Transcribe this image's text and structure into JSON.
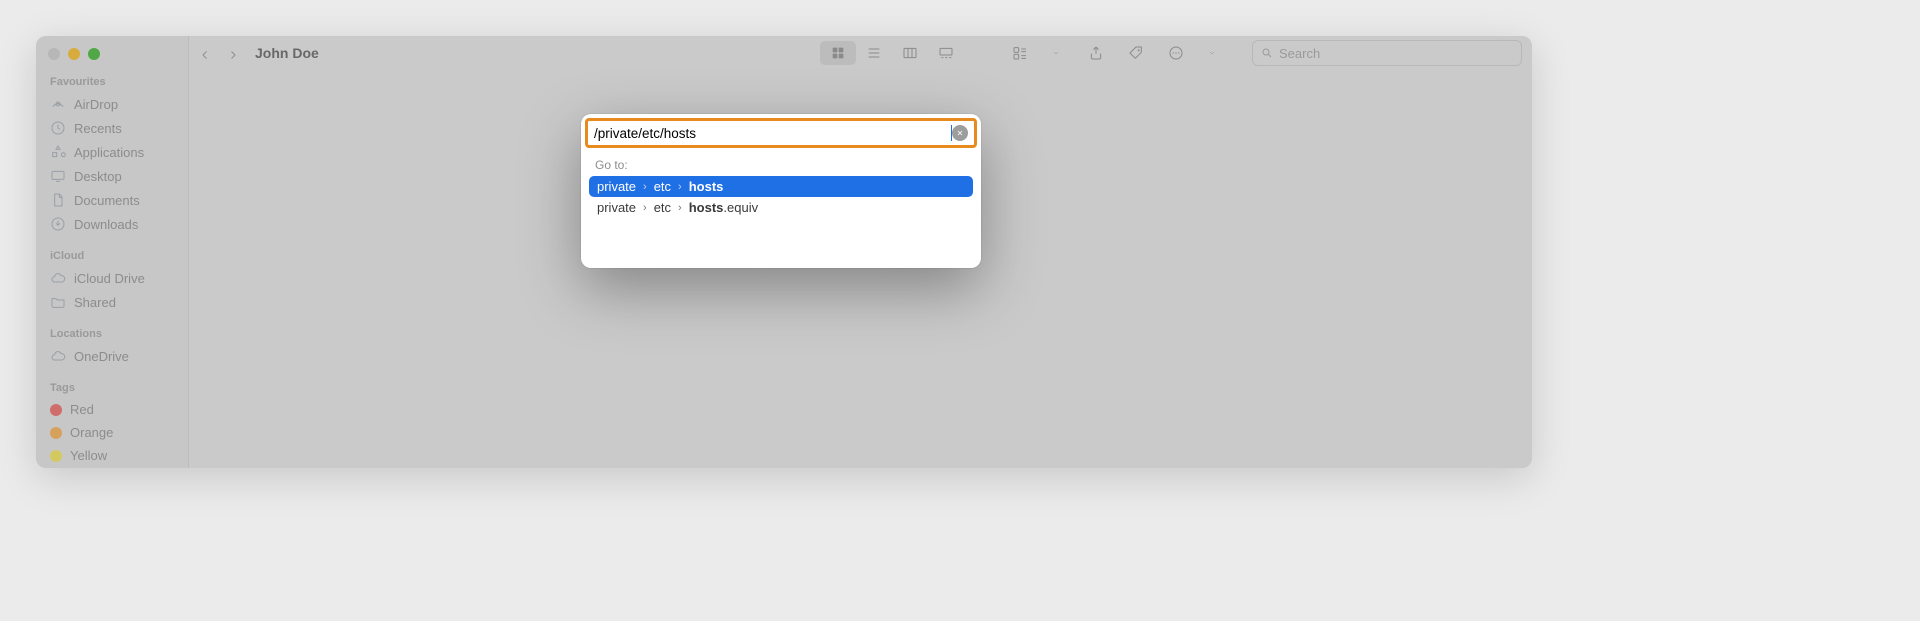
{
  "window": {
    "title": "John Doe",
    "search_placeholder": "Search"
  },
  "sidebar": {
    "sections": [
      {
        "title": "Favourites",
        "items": [
          {
            "icon": "airdrop-icon",
            "label": "AirDrop"
          },
          {
            "icon": "clock-icon",
            "label": "Recents"
          },
          {
            "icon": "apps-icon",
            "label": "Applications"
          },
          {
            "icon": "desktop-icon",
            "label": "Desktop"
          },
          {
            "icon": "document-icon",
            "label": "Documents"
          },
          {
            "icon": "download-icon",
            "label": "Downloads"
          }
        ]
      },
      {
        "title": "iCloud",
        "items": [
          {
            "icon": "cloud-icon",
            "label": "iCloud Drive"
          },
          {
            "icon": "folder-icon",
            "label": "Shared"
          }
        ]
      },
      {
        "title": "Locations",
        "items": [
          {
            "icon": "cloud-icon",
            "label": "OneDrive"
          }
        ]
      },
      {
        "title": "Tags",
        "items": [
          {
            "icon": "tag-red",
            "label": "Red"
          },
          {
            "icon": "tag-orange",
            "label": "Orange"
          },
          {
            "icon": "tag-yellow",
            "label": "Yellow"
          }
        ]
      }
    ]
  },
  "goto": {
    "input_value": "/private/etc/hosts",
    "label": "Go to:",
    "results": [
      {
        "selected": true,
        "segments": [
          "private",
          "etc"
        ],
        "match_bold": "hosts",
        "match_rest": ""
      },
      {
        "selected": false,
        "segments": [
          "private",
          "etc"
        ],
        "match_bold": "hosts",
        "match_rest": ".equiv"
      }
    ]
  }
}
